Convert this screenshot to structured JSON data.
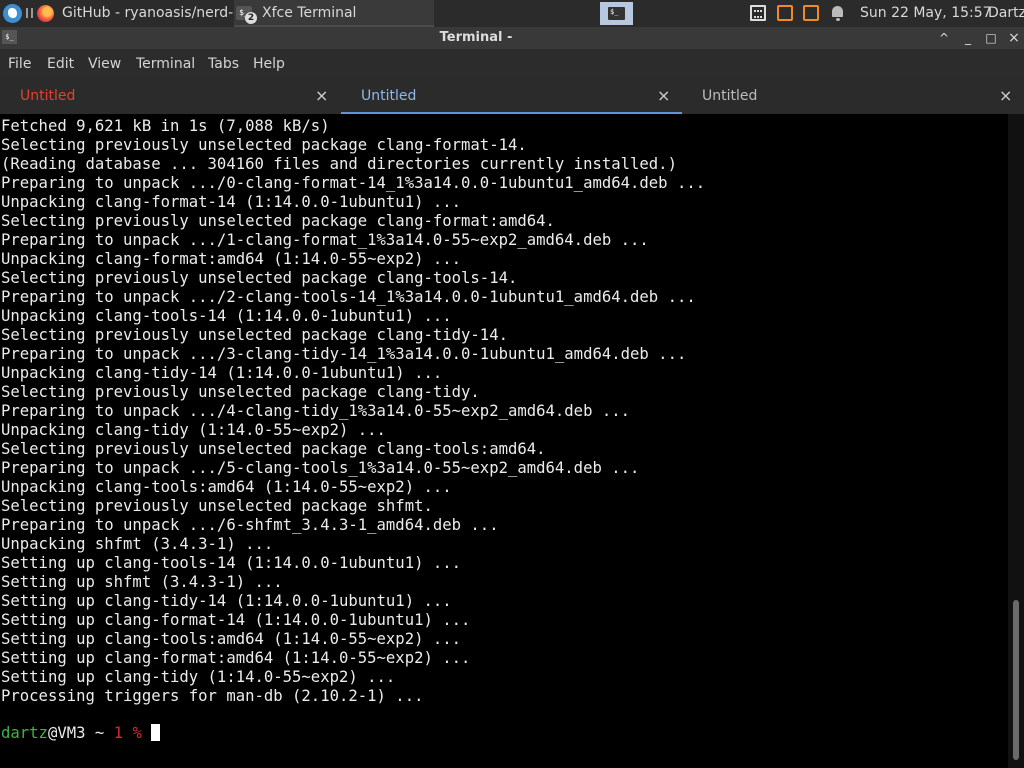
{
  "panel": {
    "tasks": [
      {
        "label": "GitHub - ryanoasis/nerd-..."
      },
      {
        "label": "Xfce Terminal",
        "badge": "2"
      }
    ],
    "term_glyph": "$_",
    "clock": "Sun 22 May, 15:57",
    "user": "Dartz"
  },
  "window": {
    "title": "Terminal -",
    "icon_glyph": "$_",
    "controls": {
      "up": "^",
      "minimize": "_",
      "maximize": "□",
      "close": "×"
    }
  },
  "menubar": {
    "items": [
      "File",
      "Edit",
      "View",
      "Terminal",
      "Tabs",
      "Help"
    ]
  },
  "tabs": [
    {
      "label": "Untitled",
      "close": "×",
      "state": "alert",
      "color": "#e8402d"
    },
    {
      "label": "Untitled",
      "close": "×",
      "state": "active",
      "color": "#8fb8ea"
    },
    {
      "label": "Untitled",
      "close": "×",
      "state": "inactive",
      "color": "#bdbdbd"
    }
  ],
  "terminal": {
    "lines": [
      "Fetched 9,621 kB in 1s (7,088 kB/s)",
      "Selecting previously unselected package clang-format-14.",
      "(Reading database ... 304160 files and directories currently installed.)",
      "Preparing to unpack .../0-clang-format-14_1%3a14.0.0-1ubuntu1_amd64.deb ...",
      "Unpacking clang-format-14 (1:14.0.0-1ubuntu1) ...",
      "Selecting previously unselected package clang-format:amd64.",
      "Preparing to unpack .../1-clang-format_1%3a14.0-55~exp2_amd64.deb ...",
      "Unpacking clang-format:amd64 (1:14.0-55~exp2) ...",
      "Selecting previously unselected package clang-tools-14.",
      "Preparing to unpack .../2-clang-tools-14_1%3a14.0.0-1ubuntu1_amd64.deb ...",
      "Unpacking clang-tools-14 (1:14.0.0-1ubuntu1) ...",
      "Selecting previously unselected package clang-tidy-14.",
      "Preparing to unpack .../3-clang-tidy-14_1%3a14.0.0-1ubuntu1_amd64.deb ...",
      "Unpacking clang-tidy-14 (1:14.0.0-1ubuntu1) ...",
      "Selecting previously unselected package clang-tidy.",
      "Preparing to unpack .../4-clang-tidy_1%3a14.0-55~exp2_amd64.deb ...",
      "Unpacking clang-tidy (1:14.0-55~exp2) ...",
      "Selecting previously unselected package clang-tools:amd64.",
      "Preparing to unpack .../5-clang-tools_1%3a14.0-55~exp2_amd64.deb ...",
      "Unpacking clang-tools:amd64 (1:14.0-55~exp2) ...",
      "Selecting previously unselected package shfmt.",
      "Preparing to unpack .../6-shfmt_3.4.3-1_amd64.deb ...",
      "Unpacking shfmt (3.4.3-1) ...",
      "Setting up clang-tools-14 (1:14.0.0-1ubuntu1) ...",
      "Setting up shfmt (3.4.3-1) ...",
      "Setting up clang-tidy-14 (1:14.0.0-1ubuntu1) ...",
      "Setting up clang-format-14 (1:14.0.0-1ubuntu1) ...",
      "Setting up clang-tools:amd64 (1:14.0-55~exp2) ...",
      "Setting up clang-format:amd64 (1:14.0-55~exp2) ...",
      "Setting up clang-tidy (1:14.0-55~exp2) ...",
      "Processing triggers for man-db (2.10.2-1) ..."
    ],
    "prompt": {
      "user": "dartz",
      "host": "@VM3 ~ ",
      "exit_code": "1",
      "symbol": " % "
    }
  }
}
